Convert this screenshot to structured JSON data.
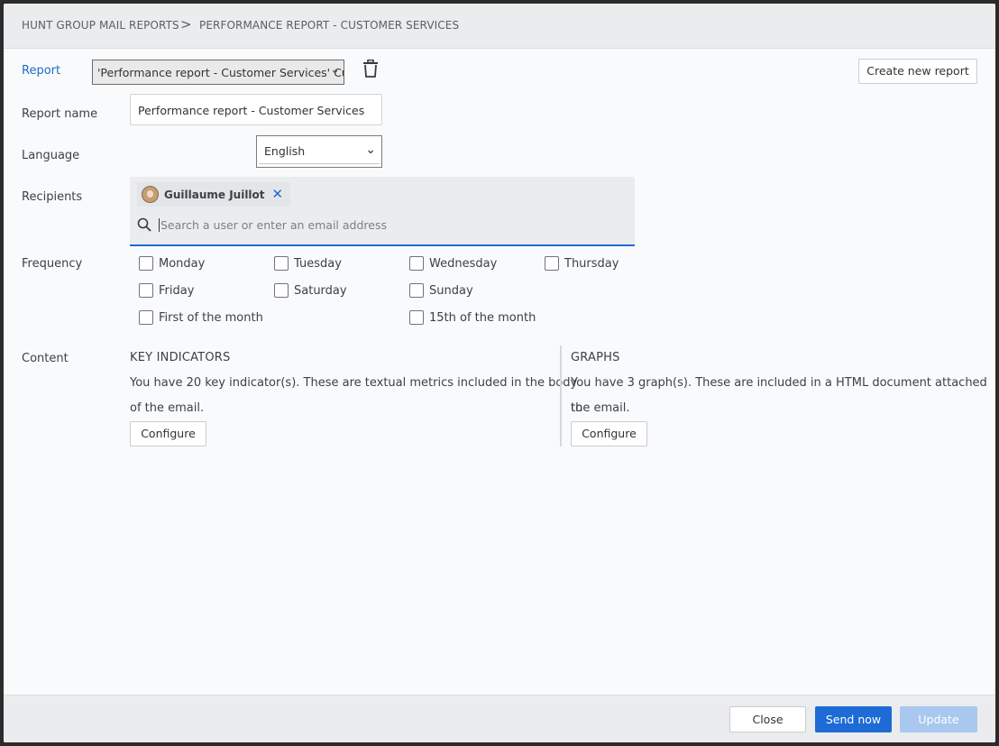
{
  "breadcrumb": {
    "root": "HUNT GROUP MAIL REPORTS",
    "separator": ">",
    "current": "PERFORMANCE REPORT - CUSTOMER SERVICES"
  },
  "report": {
    "label": "Report",
    "selected_value": "'Performance report - Customer Services' Customer Services",
    "create_label": "Create new report"
  },
  "report_name": {
    "label": "Report name",
    "value": "Performance report - Customer Services"
  },
  "language": {
    "label": "Language",
    "value": "English"
  },
  "recipients": {
    "label": "Recipients",
    "chips": [
      {
        "name": "Guillaume Juillot"
      }
    ],
    "search_placeholder": "Search a user or enter an email address"
  },
  "frequency": {
    "label": "Frequency",
    "options": [
      {
        "label": "Monday",
        "checked": false
      },
      {
        "label": "Tuesday",
        "checked": false
      },
      {
        "label": "Wednesday",
        "checked": false
      },
      {
        "label": "Thursday",
        "checked": false
      },
      {
        "label": "Friday",
        "checked": false
      },
      {
        "label": "Saturday",
        "checked": false
      },
      {
        "label": "Sunday",
        "checked": false
      },
      {
        "label": "First of the month",
        "checked": false
      },
      {
        "label": "15th of the month",
        "checked": false
      }
    ]
  },
  "content": {
    "label": "Content",
    "key_indicators": {
      "title": "KEY INDICATORS",
      "line1": "You have 20 key indicator(s). These are textual metrics included in the body",
      "line2": "of the email.",
      "button": "Configure"
    },
    "graphs": {
      "title": "GRAPHS",
      "line1": "You have 3 graph(s). These are included in a HTML document attached to",
      "line2": "the email.",
      "button": "Configure"
    }
  },
  "footer": {
    "close": "Close",
    "send_now": "Send now",
    "update": "Update"
  },
  "colors": {
    "accent": "#1e6bd6",
    "disabled": "#a8c8ef",
    "link": "#1f6bc9"
  }
}
